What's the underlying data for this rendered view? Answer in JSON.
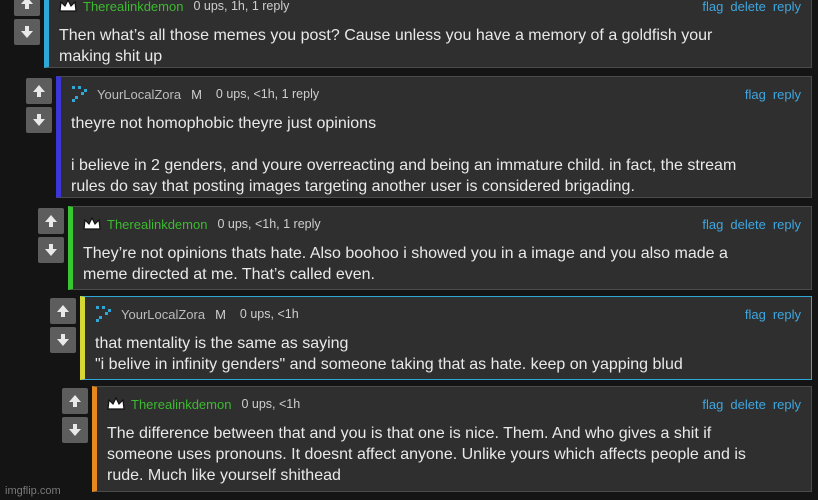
{
  "comments": [
    {
      "user": "Therealinkdemon",
      "stats": "0 ups, 1h, 1 reply",
      "actions": [
        "flag",
        "delete",
        "reply"
      ],
      "body": "Then what’s all those memes you post? Cause unless you have a memory of a goldfish your\nmaking shit up",
      "accent": "#2fa8d8"
    },
    {
      "user": "YourLocalZora",
      "badge": "M",
      "stats": "0 ups, <1h, 1 reply",
      "actions": [
        "flag",
        "reply"
      ],
      "body": "theyre not homophobic theyre just opinions\n\ni believe in 2 genders, and youre overreacting and being an immature child. in fact, the stream\nrules do say that posting images targeting another user is considered brigading.",
      "accent": "#3c36d8"
    },
    {
      "user": "Therealinkdemon",
      "stats": "0 ups, <1h, 1 reply",
      "actions": [
        "flag",
        "delete",
        "reply"
      ],
      "body": "They’re not opinions thats hate. Also boohoo i showed you in a image and you also made a\nmeme directed at me. That’s called even.",
      "accent": "#38c72e"
    },
    {
      "user": "YourLocalZora",
      "badge": "M",
      "stats": "0 ups, <1h",
      "actions": [
        "flag",
        "reply"
      ],
      "body": "that mentality is the same as saying\n\"i belive in infinity genders\" and someone taking that as hate. keep on yapping blud",
      "accent": "#d8d834"
    },
    {
      "user": "Therealinkdemon",
      "stats": "0 ups, <1h",
      "actions": [
        "flag",
        "delete",
        "reply"
      ],
      "body": "The difference between that and you is that one is nice. Them. And who gives a shit if\nsomeone uses pronouns. It doesnt affect anyone. Unlike yours which affects people and is\nrude. Much like yourself shithead",
      "accent": "#e7881e"
    }
  ],
  "watermark": "imgflip.com",
  "colors": {
    "link": "#3fa7e0",
    "username_green": "#3dba31",
    "selected_border": "#2fa8d8"
  },
  "icons": {
    "upvote": "arrow-up-icon",
    "downvote": "arrow-down-icon",
    "crown": "crown-icon",
    "zora_avatar": "pixel-avatar-icon"
  }
}
